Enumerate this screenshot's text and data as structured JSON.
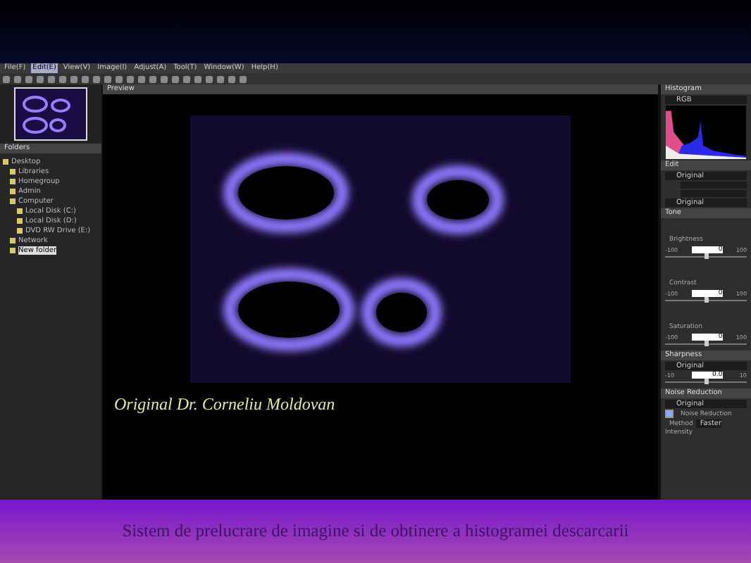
{
  "menu": [
    {
      "label": "File(F)",
      "selected": false
    },
    {
      "label": "Edit(E)",
      "selected": true
    },
    {
      "label": "View(V)",
      "selected": false
    },
    {
      "label": "Image(I)",
      "selected": false
    },
    {
      "label": "Adjust(A)",
      "selected": false
    },
    {
      "label": "Tool(T)",
      "selected": false
    },
    {
      "label": "Window(W)",
      "selected": false
    },
    {
      "label": "Help(H)",
      "selected": false
    }
  ],
  "folders": {
    "title": "Folders",
    "tree": [
      {
        "label": "Desktop",
        "selected": false,
        "children": [
          {
            "label": "Libraries",
            "selected": false
          },
          {
            "label": "Homegroup",
            "selected": false
          },
          {
            "label": "Admin",
            "selected": false
          },
          {
            "label": "Computer",
            "selected": false,
            "children": [
              {
                "label": "Local Disk (C:)",
                "selected": false
              },
              {
                "label": "Local Disk (D:)",
                "selected": false
              },
              {
                "label": "DVD RW Drive (E:)",
                "selected": false
              }
            ]
          },
          {
            "label": "Network",
            "selected": false
          },
          {
            "label": "New folder",
            "selected": true
          }
        ]
      }
    ]
  },
  "preview": {
    "title": "Preview",
    "caption": "Original Dr. Corneliu Moldovan"
  },
  "histogram": {
    "title": "Histogram",
    "channel": "RGB"
  },
  "edit": {
    "title": "Edit",
    "preset": "Original",
    "preset_2": "Original"
  },
  "tone": {
    "title": "Tone",
    "sliders": [
      {
        "label": "Brightness",
        "min": "-100",
        "max": "100",
        "value": "0",
        "level": 0.5
      },
      {
        "label": "Contrast",
        "min": "-100",
        "max": "100",
        "value": "0",
        "level": 0.5
      },
      {
        "label": "Saturation",
        "min": "-100",
        "max": "100",
        "value": "0",
        "level": 0.5
      }
    ]
  },
  "sharpness": {
    "title": "Sharpness",
    "preset": "Original",
    "slider": {
      "min": "-10",
      "max": "10",
      "value": "0.0",
      "level": 0.5
    }
  },
  "noise": {
    "title": "Noise Reduction",
    "preset": "Original",
    "checkbox": {
      "label": "Noise Reduction",
      "checked": true
    },
    "method_label": "Method",
    "method": "Faster",
    "intensity_label": "Intensity"
  },
  "slide_caption": "Sistem de prelucrare de imagine si de obtinere a histogramei descarcarii"
}
